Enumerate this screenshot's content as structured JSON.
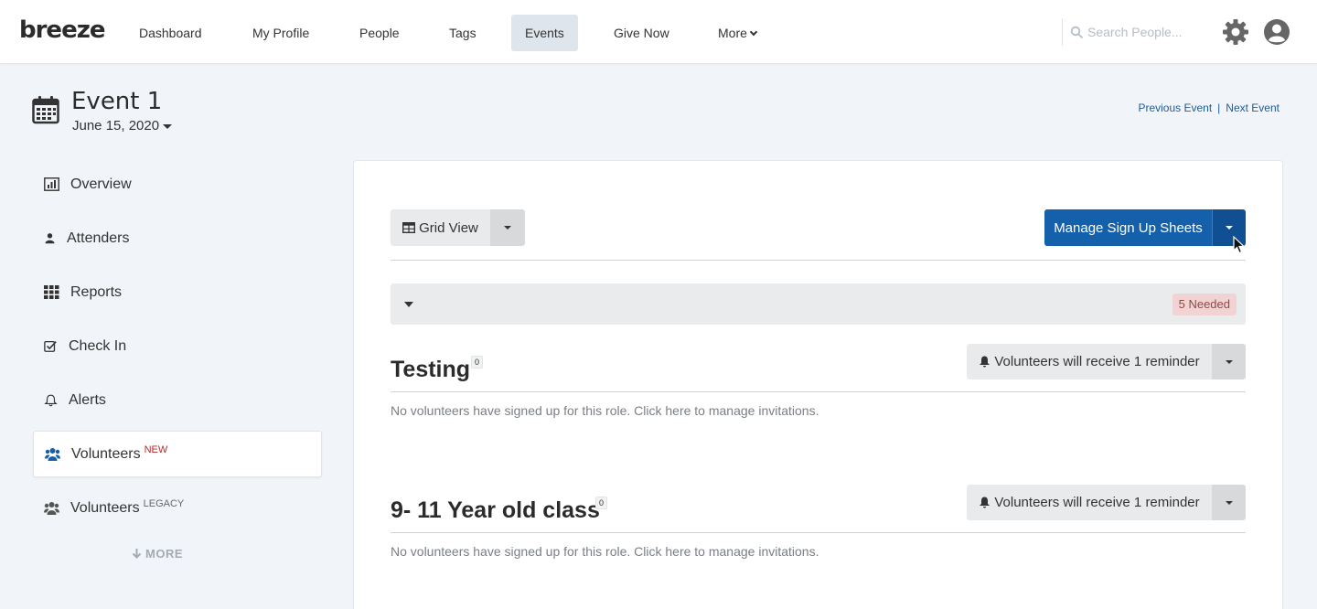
{
  "nav": {
    "logo": "breeze",
    "items": [
      {
        "label": "Dashboard"
      },
      {
        "label": "My Profile"
      },
      {
        "label": "People"
      },
      {
        "label": "Tags"
      },
      {
        "label": "Events"
      },
      {
        "label": "Give Now"
      },
      {
        "label": "More"
      }
    ],
    "search_placeholder": "Search People...",
    "gear_icon": "gear-icon",
    "avatar_icon": "user-circle-icon"
  },
  "header": {
    "title": "Event 1",
    "date": "June 15, 2020",
    "previous_event": "Previous Event",
    "separator": "|",
    "next_event": "Next Event"
  },
  "sidebar": {
    "items": [
      {
        "label": "Overview",
        "icon": "bar-chart-icon"
      },
      {
        "label": "Attenders",
        "icon": "user-icon"
      },
      {
        "label": "Reports",
        "icon": "grid-icon"
      },
      {
        "label": "Check In",
        "icon": "checkbox-icon"
      },
      {
        "label": "Alerts",
        "icon": "bell-icon"
      },
      {
        "label": "Volunteers",
        "icon": "users-icon",
        "tag": "NEW"
      },
      {
        "label": "Volunteers",
        "icon": "users-icon",
        "tag": "LEGACY"
      }
    ],
    "more_label": "MORE"
  },
  "toolbar": {
    "grid_view_label": "Grid View",
    "manage_label": "Manage Sign Up Sheets"
  },
  "sheet": {
    "needed_badge": "5 Needed"
  },
  "roles": [
    {
      "title": "Testing",
      "count": "0",
      "reminder": "Volunteers will receive 1 reminder",
      "empty_text": "No volunteers have signed up for this role. Click here to manage invitations."
    },
    {
      "title": "9- 11 Year old class",
      "count": "0",
      "reminder": "Volunteers will receive 1 reminder",
      "empty_text": "No volunteers have signed up for this role. Click here to manage invitations."
    }
  ],
  "colors": {
    "primary": "#1560aa",
    "background": "#f1f5f9",
    "badge_bg": "#f2d3d3",
    "new_tag": "#b02a2a"
  }
}
